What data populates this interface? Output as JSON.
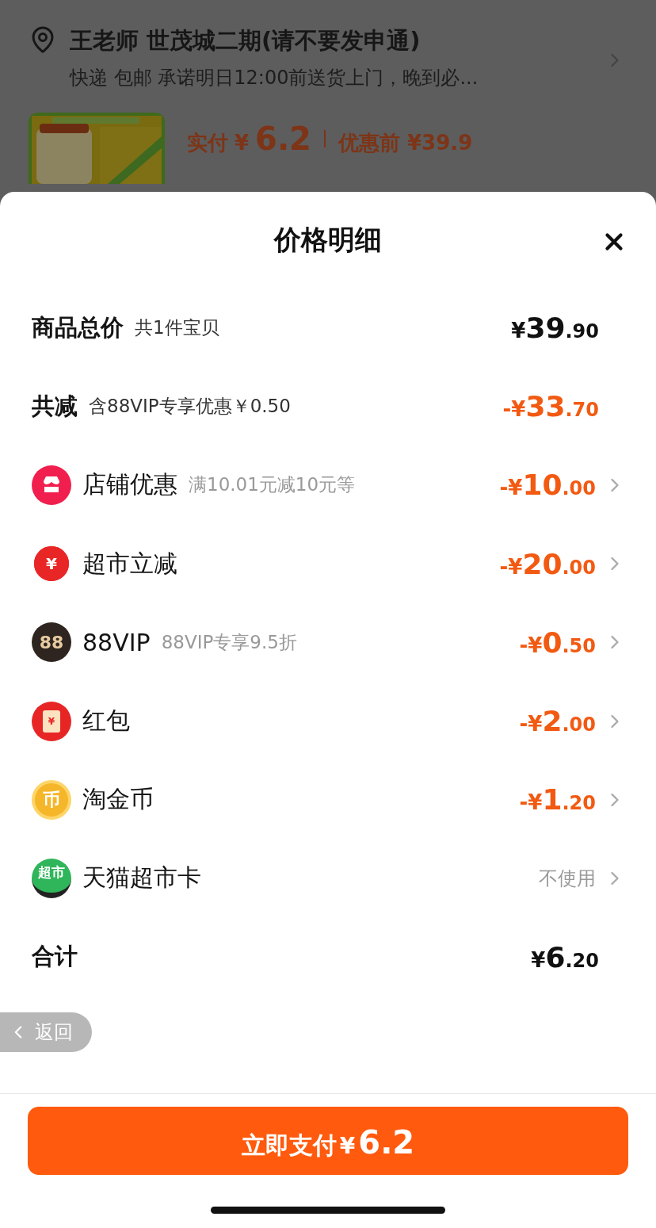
{
  "background_page": {
    "address": {
      "name_line": "王老师 世茂城二期(请不要发申通)",
      "delivery_line": "快递 包邮 承诺明日12:00前送货上门，晚到必..."
    },
    "product": {
      "paid_label": "实付",
      "paid_currency": "¥",
      "paid_amount": "6.2",
      "before_label": "优惠前 ¥39.9"
    }
  },
  "sheet": {
    "title": "价格明细",
    "rows": [
      {
        "kind": "summary",
        "label": "商品总价",
        "note": "共1件宝贝",
        "amount": {
          "prefix": "¥",
          "integer": "39",
          "decimal": ".90"
        },
        "highlight": false,
        "chevron": false
      },
      {
        "kind": "summary",
        "label": "共减",
        "note": "含88VIP专享优惠￥0.50",
        "amount": {
          "prefix": "-¥",
          "integer": "33",
          "decimal": ".70"
        },
        "highlight": true,
        "chevron": false
      },
      {
        "kind": "shop",
        "label": "店铺优惠",
        "note": "满10.01元减10元等",
        "amount": {
          "prefix": "-¥",
          "integer": "10",
          "decimal": ".00"
        },
        "highlight": true,
        "chevron": true
      },
      {
        "kind": "instant",
        "icon_text": "¥",
        "label": "超市立减",
        "amount": {
          "prefix": "-¥",
          "integer": "20",
          "decimal": ".00"
        },
        "highlight": true,
        "chevron": true
      },
      {
        "kind": "vip",
        "icon_text": "88",
        "label": "88VIP",
        "note": "88VIP专享9.5折",
        "amount": {
          "prefix": "-¥",
          "integer": "0",
          "decimal": ".50"
        },
        "highlight": true,
        "chevron": true
      },
      {
        "kind": "envelope",
        "icon_text": "¥",
        "label": "红包",
        "amount": {
          "prefix": "-¥",
          "integer": "2",
          "decimal": ".00"
        },
        "highlight": true,
        "chevron": true
      },
      {
        "kind": "coin",
        "icon_text": "币",
        "label": "淘金币",
        "amount": {
          "prefix": "-¥",
          "integer": "1",
          "decimal": ".20"
        },
        "highlight": true,
        "chevron": true
      },
      {
        "kind": "market",
        "icon_text": "超市",
        "label": "天猫超市卡",
        "status": "不使用",
        "highlight": false,
        "chevron": true
      },
      {
        "kind": "summary",
        "label": "合计",
        "amount": {
          "prefix": "¥",
          "integer": "6",
          "decimal": ".20"
        },
        "highlight": false,
        "chevron": false
      }
    ],
    "back_button": "返回",
    "pay_button": {
      "label": "立即支付",
      "currency": "¥",
      "amount": "6.2"
    }
  }
}
